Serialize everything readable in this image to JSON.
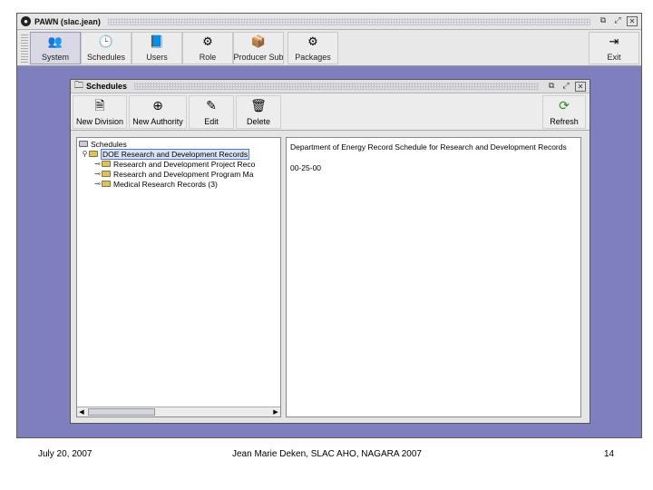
{
  "app": {
    "title": "PAWN (slac.jean)",
    "logo_glyph": "❶",
    "toolbar": [
      {
        "label": "System",
        "icon": "users-icon",
        "glyph": "👥"
      },
      {
        "label": "Schedules",
        "icon": "schedules-clock-icon",
        "glyph": "🕒"
      },
      {
        "label": "Users",
        "icon": "user-book-icon",
        "glyph": "📘"
      },
      {
        "label": "Role",
        "icon": "role-icon",
        "glyph": "⚙"
      },
      {
        "label": "Producer Sub",
        "icon": "producer-icon",
        "glyph": "📦"
      },
      {
        "label": "Packages",
        "icon": "packages-icon",
        "glyph": "⚙"
      }
    ],
    "exit_label": "Exit",
    "exit_glyph": "⇥"
  },
  "schedules": {
    "title": "Schedules",
    "toolbar": [
      {
        "label": "New Division",
        "icon": "new-division-icon",
        "glyph": "🗎"
      },
      {
        "label": "New Authority",
        "icon": "new-authority-icon",
        "glyph": "⊕"
      },
      {
        "label": "Edit",
        "icon": "edit-icon",
        "glyph": "✎"
      },
      {
        "label": "Delete",
        "icon": "delete-trash-icon",
        "glyph": "🗑"
      }
    ],
    "refresh_label": "Refresh",
    "refresh_glyph": "⟳",
    "tree": {
      "root": "Schedules",
      "nodes": [
        {
          "label": "DOE Research and Development Records",
          "selected": true
        },
        {
          "label": "Research and Development Project Reco"
        },
        {
          "label": "Research and Development Program Ma"
        },
        {
          "label": "Medical Research Records (3)"
        }
      ]
    },
    "detail": {
      "title": "Department of Energy Record Schedule for Research and Development Records",
      "code": "00-25-00"
    }
  },
  "footer": {
    "date": "July 20, 2007",
    "author": "Jean Marie Deken, SLAC AHO, NAGARA 2007",
    "page": "14"
  },
  "colors": {
    "desktop": "#7f7fbf",
    "selection": "#dbe4f7",
    "folder": "#d9c36a"
  }
}
